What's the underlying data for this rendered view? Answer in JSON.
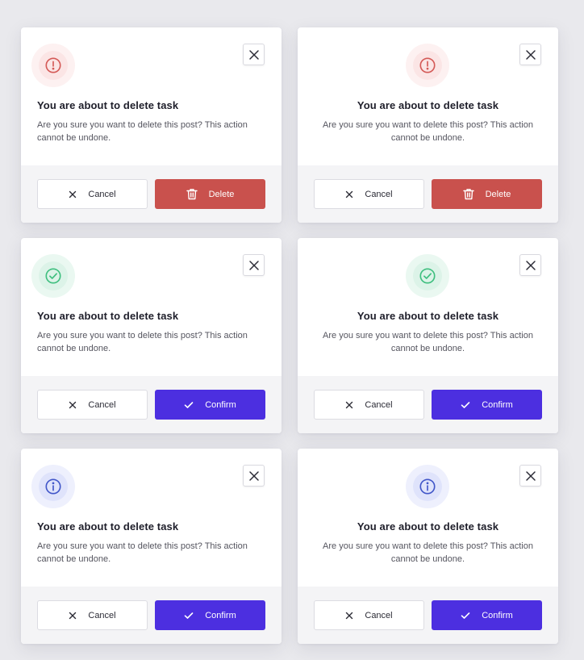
{
  "colors": {
    "page_bg": "#e9e9ed",
    "danger": "#c9514d",
    "danger_icon": "#d45a57",
    "success_icon": "#3fbf7f",
    "info_icon": "#4257c9",
    "confirm": "#4c2fe0"
  },
  "modals": [
    {
      "variant": "danger",
      "align": "left",
      "status_icon": "alert-circle-icon",
      "title": "You are about to delete task",
      "body": "Are you sure you want to delete this post? This action cannot be undone.",
      "cancel_label": "Cancel",
      "primary_label": "Delete",
      "primary_icon": "trash-icon"
    },
    {
      "variant": "danger",
      "align": "center",
      "status_icon": "alert-circle-icon",
      "title": "You are about to delete task",
      "body": "Are you sure you want to delete this post? This action cannot be undone.",
      "cancel_label": "Cancel",
      "primary_label": "Delete",
      "primary_icon": "trash-icon"
    },
    {
      "variant": "success",
      "align": "left",
      "status_icon": "check-circle-icon",
      "title": "You are about to delete task",
      "body": "Are you sure you want to delete this post? This action cannot be undone.",
      "cancel_label": "Cancel",
      "primary_label": "Confirm",
      "primary_icon": "check-icon"
    },
    {
      "variant": "success",
      "align": "center",
      "status_icon": "check-circle-icon",
      "title": "You are about to delete task",
      "body": "Are you sure you want to delete this post? This action cannot be undone.",
      "cancel_label": "Cancel",
      "primary_label": "Confirm",
      "primary_icon": "check-icon"
    },
    {
      "variant": "info",
      "align": "left",
      "status_icon": "info-circle-icon",
      "title": "You are about to delete task",
      "body": "Are you sure you want to delete this post? This action cannot be undone.",
      "cancel_label": "Cancel",
      "primary_label": "Confirm",
      "primary_icon": "check-icon"
    },
    {
      "variant": "info",
      "align": "center",
      "status_icon": "info-circle-icon",
      "title": "You are about to delete task",
      "body": "Are you sure you want to delete this post? This action cannot be undone.",
      "cancel_label": "Cancel",
      "primary_label": "Confirm",
      "primary_icon": "check-icon"
    }
  ]
}
